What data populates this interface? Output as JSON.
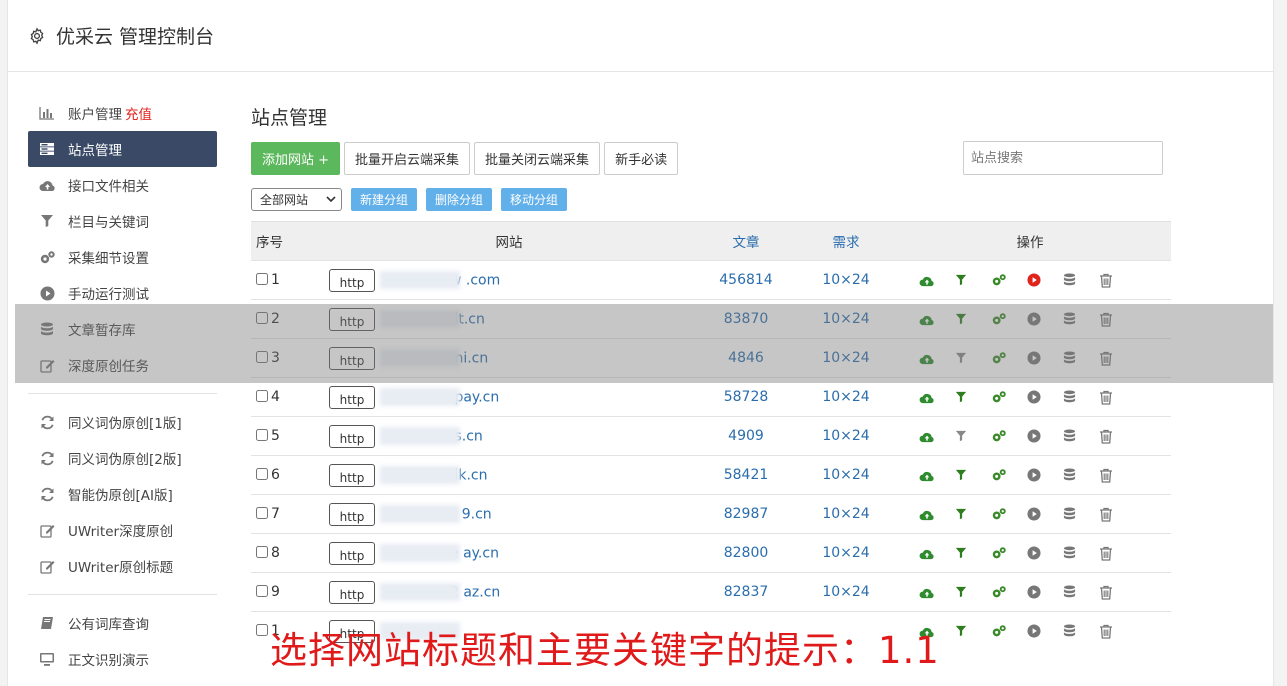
{
  "app": {
    "title": "优采云 管理控制台"
  },
  "sidebar": {
    "group1": [
      {
        "label": "账户管理",
        "extra": "充值",
        "icon": "bar-chart-icon"
      },
      {
        "label": "站点管理",
        "icon": "server-icon",
        "active": true
      },
      {
        "label": "接口文件相关",
        "icon": "cloud-upload-icon"
      },
      {
        "label": "栏目与关键词",
        "icon": "filter-icon"
      },
      {
        "label": "采集细节设置",
        "icon": "gears-icon"
      },
      {
        "label": "手动运行测试",
        "icon": "play-circle-icon"
      },
      {
        "label": "文章暂存库",
        "icon": "database-icon"
      },
      {
        "label": "深度原创任务",
        "icon": "edit-icon"
      }
    ],
    "group2": [
      {
        "label": "同义词伪原创[1版]",
        "icon": "refresh-icon"
      },
      {
        "label": "同义词伪原创[2版]",
        "icon": "refresh-icon"
      },
      {
        "label": "智能伪原创[AI版]",
        "icon": "refresh-icon"
      },
      {
        "label": "UWriter深度原创",
        "icon": "edit-icon"
      },
      {
        "label": "UWriter原创标题",
        "icon": "edit-icon"
      }
    ],
    "group3": [
      {
        "label": "公有词库查询",
        "icon": "book-icon"
      },
      {
        "label": "正文识别演示",
        "icon": "monitor-icon"
      }
    ]
  },
  "main": {
    "title": "站点管理",
    "toolbar": {
      "add_label": "添加网站 +",
      "batch_on_label": "批量开启云端采集",
      "batch_off_label": "批量关闭云端采集",
      "guide_label": "新手必读",
      "search_placeholder": "站点搜索"
    },
    "groupbar": {
      "select_value": "全部网站",
      "new_group": "新建分组",
      "delete_group": "删除分组",
      "move_group": "移动分组"
    },
    "table": {
      "headers": {
        "no": "序号",
        "site": "网站",
        "articles": "文章",
        "demand": "需求",
        "ops": "操作"
      },
      "rows": [
        {
          "no": "1",
          "proto": "http",
          "site": "w          .com",
          "articles": "456814",
          "demand": "10×24",
          "play_active": true,
          "filter_active": true
        },
        {
          "no": "2",
          "proto": "http",
          "site": "        lt.cn",
          "articles": "83870",
          "demand": "10×24",
          "play_active": false,
          "filter_active": true
        },
        {
          "no": "3",
          "proto": "http",
          "site": "        ni.cn",
          "articles": "4846",
          "demand": "10×24",
          "play_active": false,
          "filter_active": false
        },
        {
          "no": "4",
          "proto": "http",
          "site": "       pay.cn",
          "articles": "58728",
          "demand": "10×24",
          "play_active": false,
          "filter_active": true
        },
        {
          "no": "5",
          "proto": "http",
          "site": "        s.cn",
          "articles": "4909",
          "demand": "10×24",
          "play_active": false,
          "filter_active": false
        },
        {
          "no": "6",
          "proto": "http",
          "site": "        ik.cn",
          "articles": "58421",
          "demand": "10×24",
          "play_active": false,
          "filter_active": true
        },
        {
          "no": "7",
          "proto": "http",
          "site": "s    9.cn",
          "articles": "82987",
          "demand": "10×24",
          "play_active": false,
          "filter_active": true
        },
        {
          "no": "8",
          "proto": "http",
          "site": "e     ay.cn",
          "articles": "82800",
          "demand": "10×24",
          "play_active": false,
          "filter_active": true
        },
        {
          "no": "9",
          "proto": "http",
          "site": "2     az.cn",
          "articles": "82837",
          "demand": "10×24",
          "play_active": false,
          "filter_active": true
        },
        {
          "no": "1",
          "proto": "http",
          "site": "",
          "articles": "",
          "demand": "",
          "play_active": false,
          "filter_active": true
        }
      ]
    }
  },
  "caption": "选择网站标题和主要关键字的提示：1.1",
  "colors": {
    "sidebar_active": "#3a4a66",
    "green": "#5cb85c",
    "link": "#2a6dad",
    "caption": "#e01a1a",
    "play_active": "#e0241d"
  }
}
